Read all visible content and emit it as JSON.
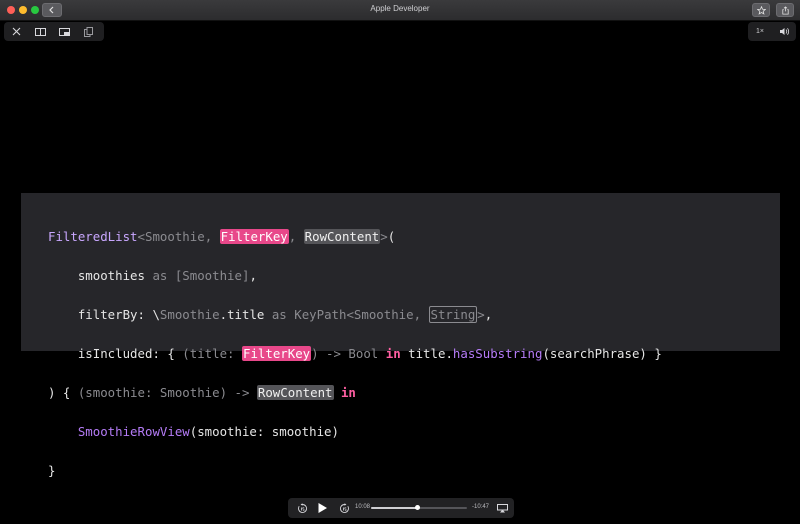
{
  "window": {
    "title": "Apple Developer"
  },
  "toolbar": {
    "back_icon": "chevron-left-icon",
    "favorite_icon": "star-icon",
    "share_icon": "share-icon"
  },
  "video_controls": {
    "close_icon": "close-icon",
    "split_icon": "split-view-icon",
    "pip_icon": "picture-in-picture-icon",
    "copy_icon": "copy-icon",
    "playback_rate": "1×",
    "volume_icon": "speaker-icon"
  },
  "code": {
    "l1": {
      "fn": "FilteredList",
      "lt": "<",
      "t1": "Smoothie",
      "c1": ", ",
      "p1": "FilterKey",
      "c2": ", ",
      "g1": "RowContent",
      "gt": ">",
      "open": "("
    },
    "l2": {
      "indent": "    ",
      "label": "smoothies",
      "as": " as ",
      "type": "[Smoothie]",
      "comma": ","
    },
    "l3": {
      "indent": "    ",
      "label": "filterBy: ",
      "bs": "\\",
      "t1": "Smoothie",
      "dot": ".",
      "prop": "title",
      "as": " as ",
      "kp": "KeyPath<Smoothie, ",
      "o1": "String",
      "gt": ">",
      "comma": ","
    },
    "l4": {
      "indent": "    ",
      "label": "isIncluded: ",
      "brace": "{ ",
      "po": "(title: ",
      "p1": "FilterKey",
      "pc": ")",
      "arrow": " -> Bool ",
      "in": "in",
      "sp": " ",
      "obj": "title",
      "dot": ".",
      "method": "hasSubstring",
      "args": "(searchPhrase) }"
    },
    "l5": {
      "close": ") { ",
      "po": "(smoothie: Smoothie) -> ",
      "g1": "RowContent",
      "sp": " ",
      "in": "in"
    },
    "l6": {
      "indent": "    ",
      "type": "SmoothieRowView",
      "args": "(smoothie: smoothie)"
    },
    "l7": {
      "close": "}"
    }
  },
  "playback": {
    "skip_back_icon": "skip-back-15-icon",
    "play_icon": "play-icon",
    "skip_forward_icon": "skip-forward-15-icon",
    "elapsed": "10:08",
    "remaining": "-10:47",
    "progress": 0.485,
    "airplay_icon": "airplay-icon"
  }
}
